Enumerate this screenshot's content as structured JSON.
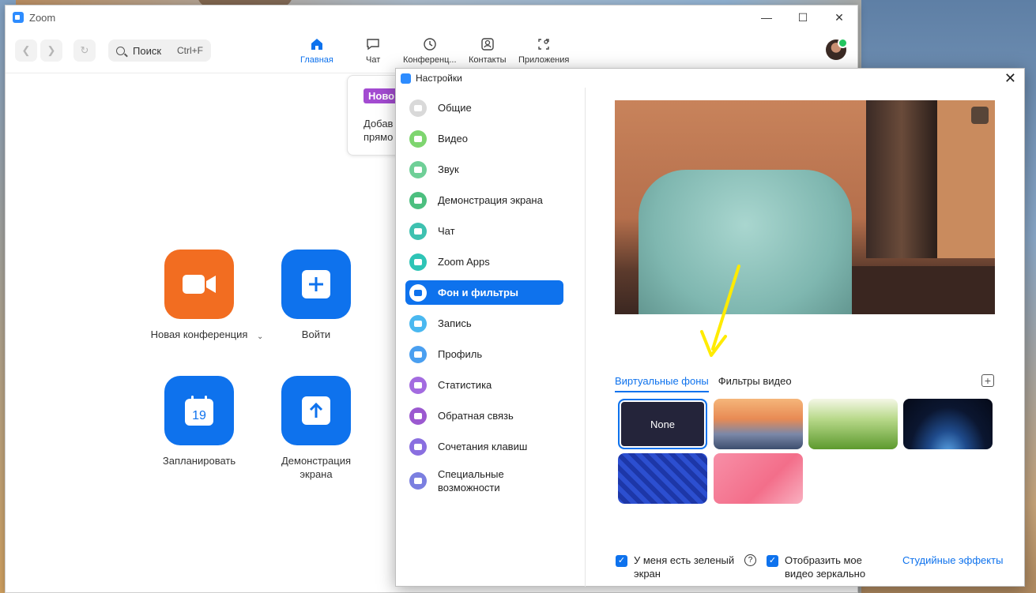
{
  "main_window": {
    "title": "Zoom",
    "search": {
      "label": "Поиск",
      "shortcut": "Ctrl+F"
    },
    "tabs": [
      {
        "label": "Главная",
        "icon": "home-icon",
        "active": true
      },
      {
        "label": "Чат",
        "icon": "chat-icon",
        "active": false
      },
      {
        "label": "Конференц...",
        "icon": "clock-icon",
        "active": false
      },
      {
        "label": "Контакты",
        "icon": "contacts-icon",
        "active": false
      },
      {
        "label": "Приложения",
        "icon": "apps-icon",
        "active": false
      }
    ],
    "notification": {
      "badge": "Ново",
      "line1": "Добав",
      "line2": "прямо"
    },
    "home_buttons": [
      {
        "label": "Новая конференция",
        "icon": "video-camera-icon",
        "color": "#f26d21"
      },
      {
        "label": "Войти",
        "icon": "plus-icon",
        "color": "#0e72ed"
      },
      {
        "label": "Запланировать",
        "icon": "calendar-icon",
        "color": "#0e72ed",
        "calendar_day": "19"
      },
      {
        "label": "Демонстрация экрана",
        "icon": "share-arrow-icon",
        "color": "#0e72ed"
      }
    ]
  },
  "settings": {
    "title": "Настройки",
    "sidebar": [
      {
        "label": "Общие",
        "icon": "gear-icon",
        "color": "#d9d9d9"
      },
      {
        "label": "Видео",
        "icon": "video-icon",
        "color": "#7ed56f"
      },
      {
        "label": "Звук",
        "icon": "headphones-icon",
        "color": "#6fcf97"
      },
      {
        "label": "Демонстрация экрана",
        "icon": "screen-share-icon",
        "color": "#4cbf7f"
      },
      {
        "label": "Чат",
        "icon": "chat-bubble-icon",
        "color": "#3ec1b0"
      },
      {
        "label": "Zoom Apps",
        "icon": "apps-icon",
        "color": "#2ec4b6"
      },
      {
        "label": "Фон и фильтры",
        "icon": "person-background-icon",
        "color": "#0e72ed",
        "active": true
      },
      {
        "label": "Запись",
        "icon": "record-icon",
        "color": "#4ab8f0"
      },
      {
        "label": "Профиль",
        "icon": "profile-icon",
        "color": "#4a9ff0"
      },
      {
        "label": "Статистика",
        "icon": "bar-chart-icon",
        "color": "#a36be0"
      },
      {
        "label": "Обратная связь",
        "icon": "smile-icon",
        "color": "#9b59d0"
      },
      {
        "label": "Сочетания клавиш",
        "icon": "keyboard-icon",
        "color": "#8a6fe0"
      },
      {
        "label": "Специальные возможности",
        "icon": "accessibility-icon",
        "color": "#7b7fe0"
      }
    ],
    "background_tabs": [
      {
        "label": "Виртуальные фоны",
        "active": true
      },
      {
        "label": "Фильтры видео",
        "active": false
      }
    ],
    "thumbnails": [
      {
        "name": "none",
        "label": "None",
        "selected": true
      },
      {
        "name": "golden-gate-bridge"
      },
      {
        "name": "grass"
      },
      {
        "name": "earth-from-space"
      },
      {
        "name": "blue-pattern"
      },
      {
        "name": "pink-illustration"
      }
    ],
    "checkboxes": [
      {
        "label": "У меня есть зеленый экран",
        "checked": true
      },
      {
        "label": "Отобразить мое видео зеркально",
        "checked": true
      }
    ],
    "studio_effects_link": "Студийные эффекты"
  },
  "colors": {
    "accent": "#0e72ed",
    "orange": "#f26d21",
    "arrow": "#ffeb00"
  }
}
